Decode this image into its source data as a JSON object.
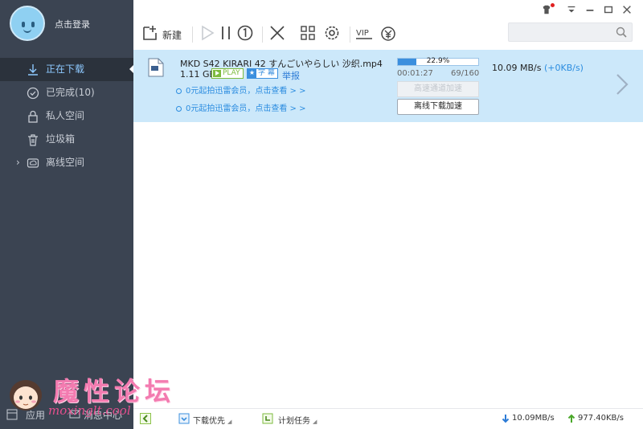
{
  "account": {
    "login_label": "点击登录"
  },
  "nav": {
    "items": [
      {
        "label": "正在下载",
        "icon": "download-icon",
        "active": true
      },
      {
        "label": "已完成(10)",
        "icon": "check-circle-icon",
        "active": false
      },
      {
        "label": "私人空间",
        "icon": "lock-icon",
        "active": false
      },
      {
        "label": "垃圾箱",
        "icon": "trash-icon",
        "active": false
      },
      {
        "label": "离线空间",
        "icon": "cloud-icon",
        "active": false,
        "expandable": true
      }
    ]
  },
  "sidebar_footer": {
    "apps_label": "应用",
    "messages_label": "消息中心"
  },
  "toolbar": {
    "new_label": "新建",
    "icons": [
      "add-task-icon",
      "start-icon",
      "pause-icon",
      "speed-limit-icon",
      "delete-icon",
      "grid-icon",
      "settings-icon",
      "vip-icon",
      "coin-icon"
    ],
    "search_placeholder": ""
  },
  "window_controls": [
    "skin-icon",
    "menu-icon",
    "minimize-icon",
    "maximize-icon",
    "close-icon"
  ],
  "task": {
    "filename": "MKD S42 KIRARI 42 すんごいやらしい 沙织.mp4",
    "size": "1.11 GB",
    "play_badge": "PLAY",
    "subtitle_badge": "字 幕",
    "report_label": "举报",
    "progress_percent": 22.9,
    "progress_text": "22.9%",
    "elapsed": "00:01:27",
    "pieces": "69/160",
    "speed": "10.09  MB/s",
    "speed_boost": "(+0KB/s)",
    "promo_1": "0元起拍迅雷会员，点击查看 > >",
    "promo_2": "0元起拍迅雷会员，点击查看 > >",
    "accel_button": "高速通道加速",
    "offline_button": "离线下载加速"
  },
  "statusbar": {
    "priority_label": "下载优先",
    "schedule_label": "计划任务",
    "download_speed": "10.09MB/s",
    "upload_speed": "977.40KB/s"
  },
  "watermark": {
    "text": "魔性论坛",
    "url": "moxinglt.cool"
  },
  "colors": {
    "sidebar_bg": "#3b4452",
    "sidebar_active": "#2b323c",
    "task_bg": "#cce8fa",
    "accent": "#3b8fde"
  }
}
